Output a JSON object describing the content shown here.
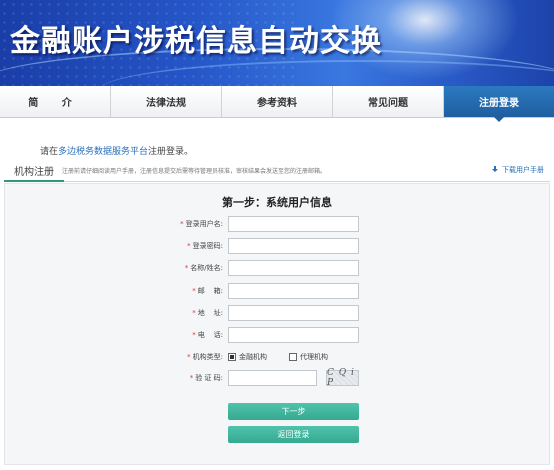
{
  "banner": {
    "title": "金融账户涉税信息自动交换"
  },
  "nav": {
    "items": [
      {
        "label": "简  介"
      },
      {
        "label": "法律法规"
      },
      {
        "label": "参考资料"
      },
      {
        "label": "常见问题"
      },
      {
        "label": "注册登录"
      }
    ],
    "active_index": 4
  },
  "notice": {
    "prefix": "请在",
    "link": "多边税务数据服务平台",
    "suffix": "注册登录。"
  },
  "tabs": {
    "active_label": "机构注册",
    "hint": "注册前请仔细阅读用户手册，注册信息提交后需等待管理员核准，审核结果会发送至您的注册邮箱。",
    "download_label": "下载用户手册"
  },
  "form": {
    "step_title": "第一步：系统用户信息",
    "fields": [
      {
        "label": "登录用户名:",
        "value": ""
      },
      {
        "label": "登录密码:",
        "value": ""
      },
      {
        "label": "名称/姓名:",
        "value": ""
      },
      {
        "label": "邮    箱:",
        "value": ""
      },
      {
        "label": "地    址:",
        "value": ""
      },
      {
        "label": "电    话:",
        "value": ""
      }
    ],
    "org_type": {
      "label": "机构类型:",
      "options": [
        "金融机构",
        "代理机构"
      ],
      "selected": "金融机构"
    },
    "captcha": {
      "label": "验 证 码:",
      "value": "",
      "image_text": "C Q i P"
    },
    "buttons": {
      "next": "下一步",
      "back": "返回登录"
    }
  },
  "colors": {
    "banner": "#2556c8",
    "nav_active": "#2c79c0",
    "button": "#3fb39b",
    "link": "#2a6fb8"
  }
}
